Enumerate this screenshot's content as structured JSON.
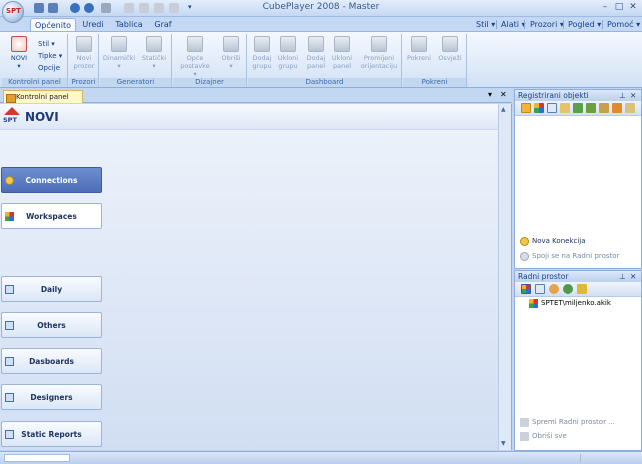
{
  "app": {
    "title": "CubePlayer 2008 - Master",
    "orb_label": "SPT"
  },
  "ribbon_tabs": [
    "Općenito",
    "Uredi",
    "Tablica",
    "Graf"
  ],
  "right_menus": [
    "Stil ▾",
    "Alati ▾",
    "Prozori ▾",
    "Pogled ▾",
    "Pomoć ▾"
  ],
  "ribbon": {
    "kontrolni": {
      "label": "Kontrolni panel",
      "novi_label": "NOVI",
      "small": [
        "Stil ▾",
        "Tipke ▾",
        "Opcije"
      ]
    },
    "prozori": {
      "label": "Prozori",
      "buttons": [
        "Novi prozor"
      ]
    },
    "generatori": {
      "label": "Generatori",
      "buttons": [
        "Dinamički",
        "Statički"
      ]
    },
    "dizajner": {
      "label": "Dizajner",
      "buttons": [
        "Opće postavke",
        "Obriši"
      ]
    },
    "dashboard": {
      "label": "Dashboard",
      "buttons": [
        "Dodaj grupu",
        "Ukloni grupu",
        "Dodaj panel",
        "Ukloni panel",
        "Promijeni orijentaciju"
      ]
    },
    "pokreni": {
      "label": "Pokreni",
      "buttons": [
        "Pokreni",
        "Osvježi"
      ]
    }
  },
  "doc": {
    "tab_label": "Kontrolni panel",
    "header_title": "NOVI",
    "logo_text": "SPT",
    "nav_buttons": [
      "Connections",
      "Workspaces",
      "Daily",
      "Others",
      "Dasboards",
      "Designers",
      "Static Reports"
    ]
  },
  "registrirani": {
    "title": "Registrirani objekti",
    "links": [
      "Nova Konekcija",
      "Spoji se na Radni prostor"
    ]
  },
  "radni": {
    "title": "Radni prostor",
    "item": "SPTET\\miljenko.akik",
    "links": [
      "Spremi Radni prostor ...",
      "Obriši sve"
    ]
  },
  "colors": {
    "accent": "#15428b",
    "selected_nav": "#5a7cc3",
    "tab_highlight": "#fff7c8"
  }
}
